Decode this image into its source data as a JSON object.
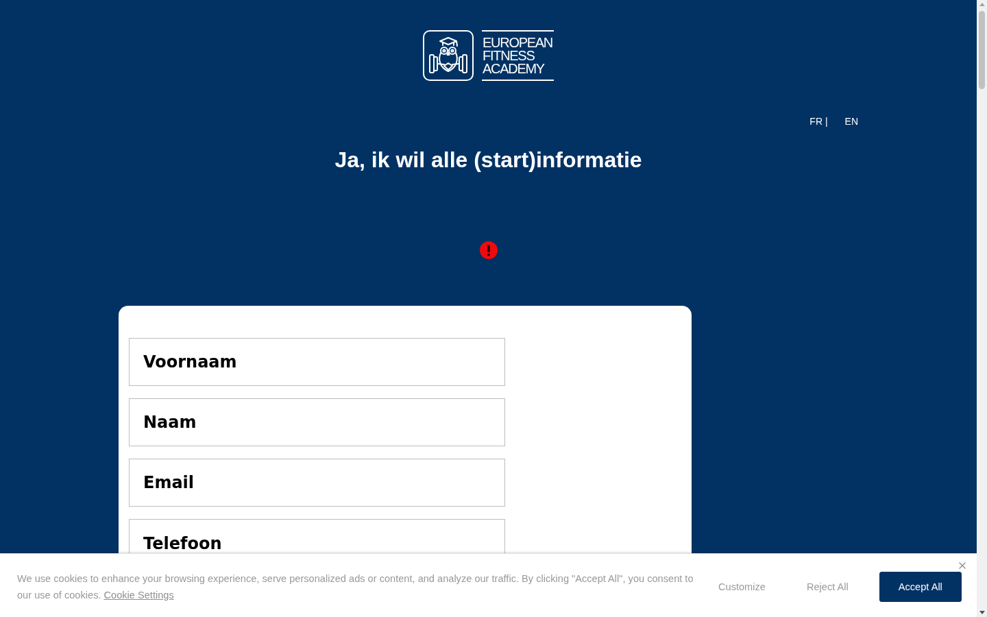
{
  "logo": {
    "lines": [
      "EUROPEAN",
      "FITNESS",
      "ACADEMY"
    ]
  },
  "languages": [
    "FR |",
    "EN"
  ],
  "title": "Ja, ik wil alle (start)informatie",
  "form": {
    "fields": [
      {
        "placeholder": "Voornaam"
      },
      {
        "placeholder": "Naam"
      },
      {
        "placeholder": "Email"
      },
      {
        "placeholder": "Telefoon"
      }
    ]
  },
  "cookie_banner": {
    "text": "We use cookies to enhance your browsing experience, serve personalized ads or content, and analyze our traffic. By clicking \"Accept All\", you consent to our use of cookies.",
    "link": "Cookie Settings",
    "buttons": [
      {
        "label": "Customize",
        "kind": "text"
      },
      {
        "label": "Reject All",
        "kind": "text"
      },
      {
        "label": "Accept All",
        "kind": "primary"
      }
    ]
  }
}
